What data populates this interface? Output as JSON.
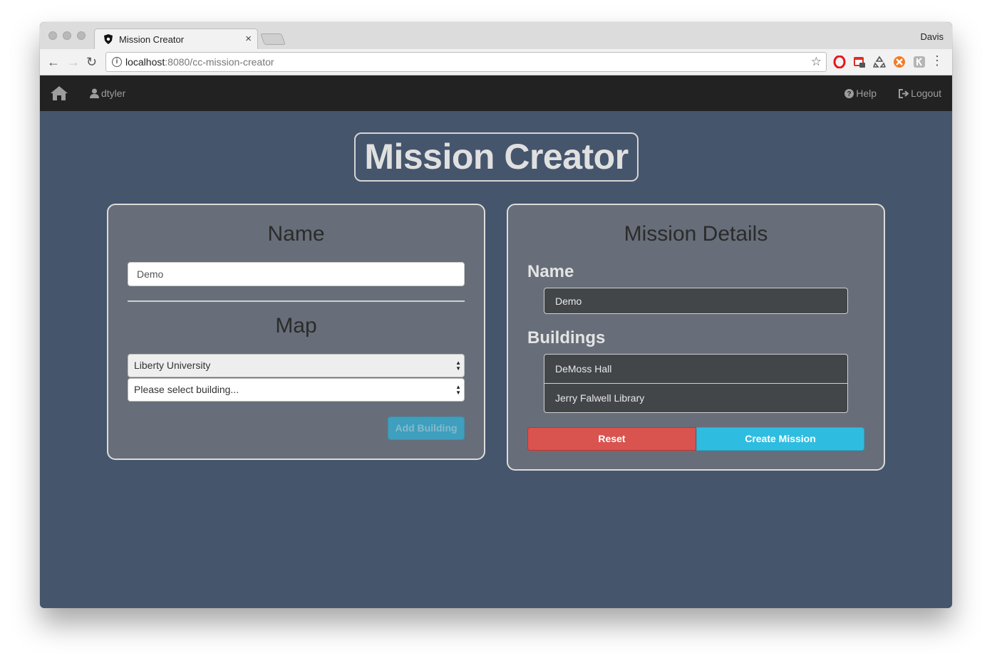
{
  "browser": {
    "tab_title": "Mission Creator",
    "tab_close": "×",
    "profile_name": "Davis",
    "url_host": "localhost",
    "url_path": ":8080/cc-mission-creator"
  },
  "navbar": {
    "user": "dtyler",
    "help": "Help",
    "logout": "Logout"
  },
  "page": {
    "title": "Mission Creator"
  },
  "left_panel": {
    "name_heading": "Name",
    "name_value": "Demo",
    "map_heading": "Map",
    "map_select": "Liberty University",
    "building_select": "Please select building...",
    "add_button": "Add Building"
  },
  "right_panel": {
    "heading": "Mission Details",
    "name_label": "Name",
    "name_value": "Demo",
    "buildings_label": "Buildings",
    "buildings": [
      "DeMoss Hall",
      "Jerry Falwell Library"
    ],
    "reset_button": "Reset",
    "create_button": "Create Mission"
  },
  "colors": {
    "page_bg": "#45556c",
    "panel_bg": "#676e79",
    "navbar_bg": "#222222",
    "danger": "#d9534f",
    "info": "#2ebde0"
  }
}
